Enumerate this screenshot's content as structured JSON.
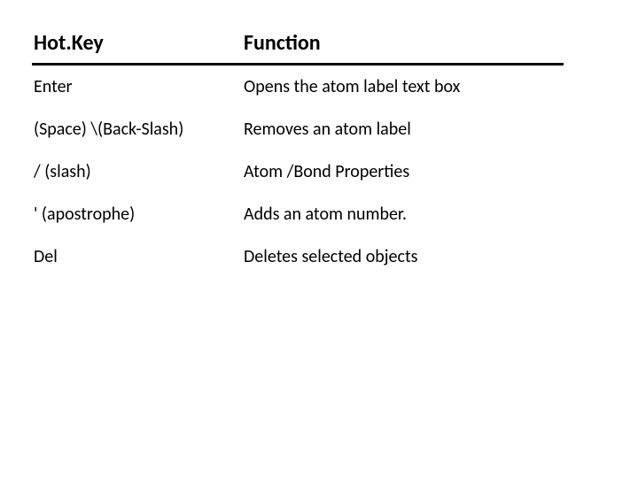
{
  "table": {
    "headers": {
      "hotkey": "Hot.Key",
      "function": "Function"
    },
    "rows": [
      {
        "hotkey": "Enter",
        "function": "Opens the atom label text box"
      },
      {
        "hotkey": "(Space) \\(Back-Slash)",
        "function": "Removes an atom label"
      },
      {
        "hotkey": "/ (slash)",
        "function": "Atom /Bond Properties"
      },
      {
        "hotkey": "' (apostrophe)",
        "function": "Adds an atom number."
      },
      {
        "hotkey": "Del",
        "function": "Deletes selected objects"
      }
    ]
  }
}
